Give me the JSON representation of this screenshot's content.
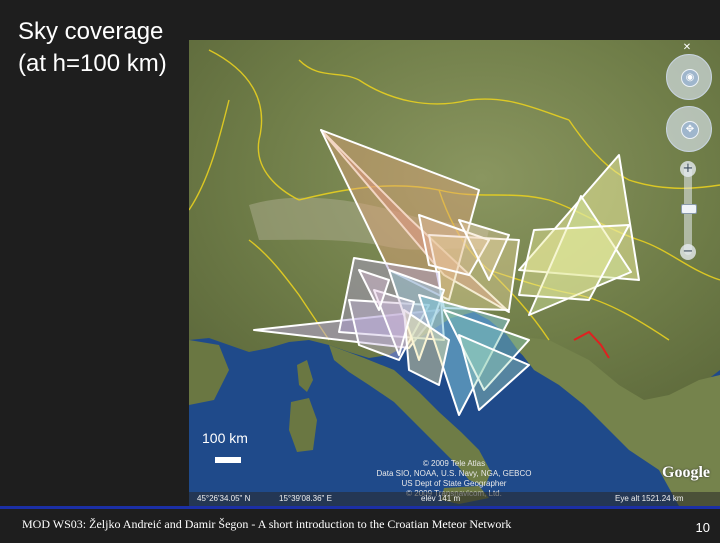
{
  "slide": {
    "title_line1": "Sky coverage",
    "title_line2": "(at h=100 km)"
  },
  "map": {
    "scale_label": "100 km",
    "attribution": [
      "© 2009 Tele Atlas",
      "Data SIO, NOAA, U.S. Navy, NGA, GEBCO",
      "US Dept of State Geographer",
      "© 2009 Transnavicom, Ltd."
    ],
    "logo_text": "Google",
    "status": {
      "latitude": "45°26'34.05\" N",
      "longitude": "15°39'08.36\" E",
      "elevation": "elev  141 m",
      "eye_altitude": "Eye alt  1521.24 km"
    },
    "controls": {
      "close_icon": "close-icon",
      "look_icon": "eye-icon",
      "move_icon": "hand-icon",
      "zoom_in": "+",
      "zoom_out": "−"
    },
    "colors": {
      "sea": "#1f4a8a",
      "land": "#7d8a52",
      "border": "#e8d020",
      "coverage_outline": "#ffffff"
    }
  },
  "footer": {
    "text": "MOD WS03: Željko Andreić and Damir Šegon - A short introduction to the Croatian Meteor Network",
    "page_number": "10",
    "accent_color": "#1b2fa6"
  }
}
